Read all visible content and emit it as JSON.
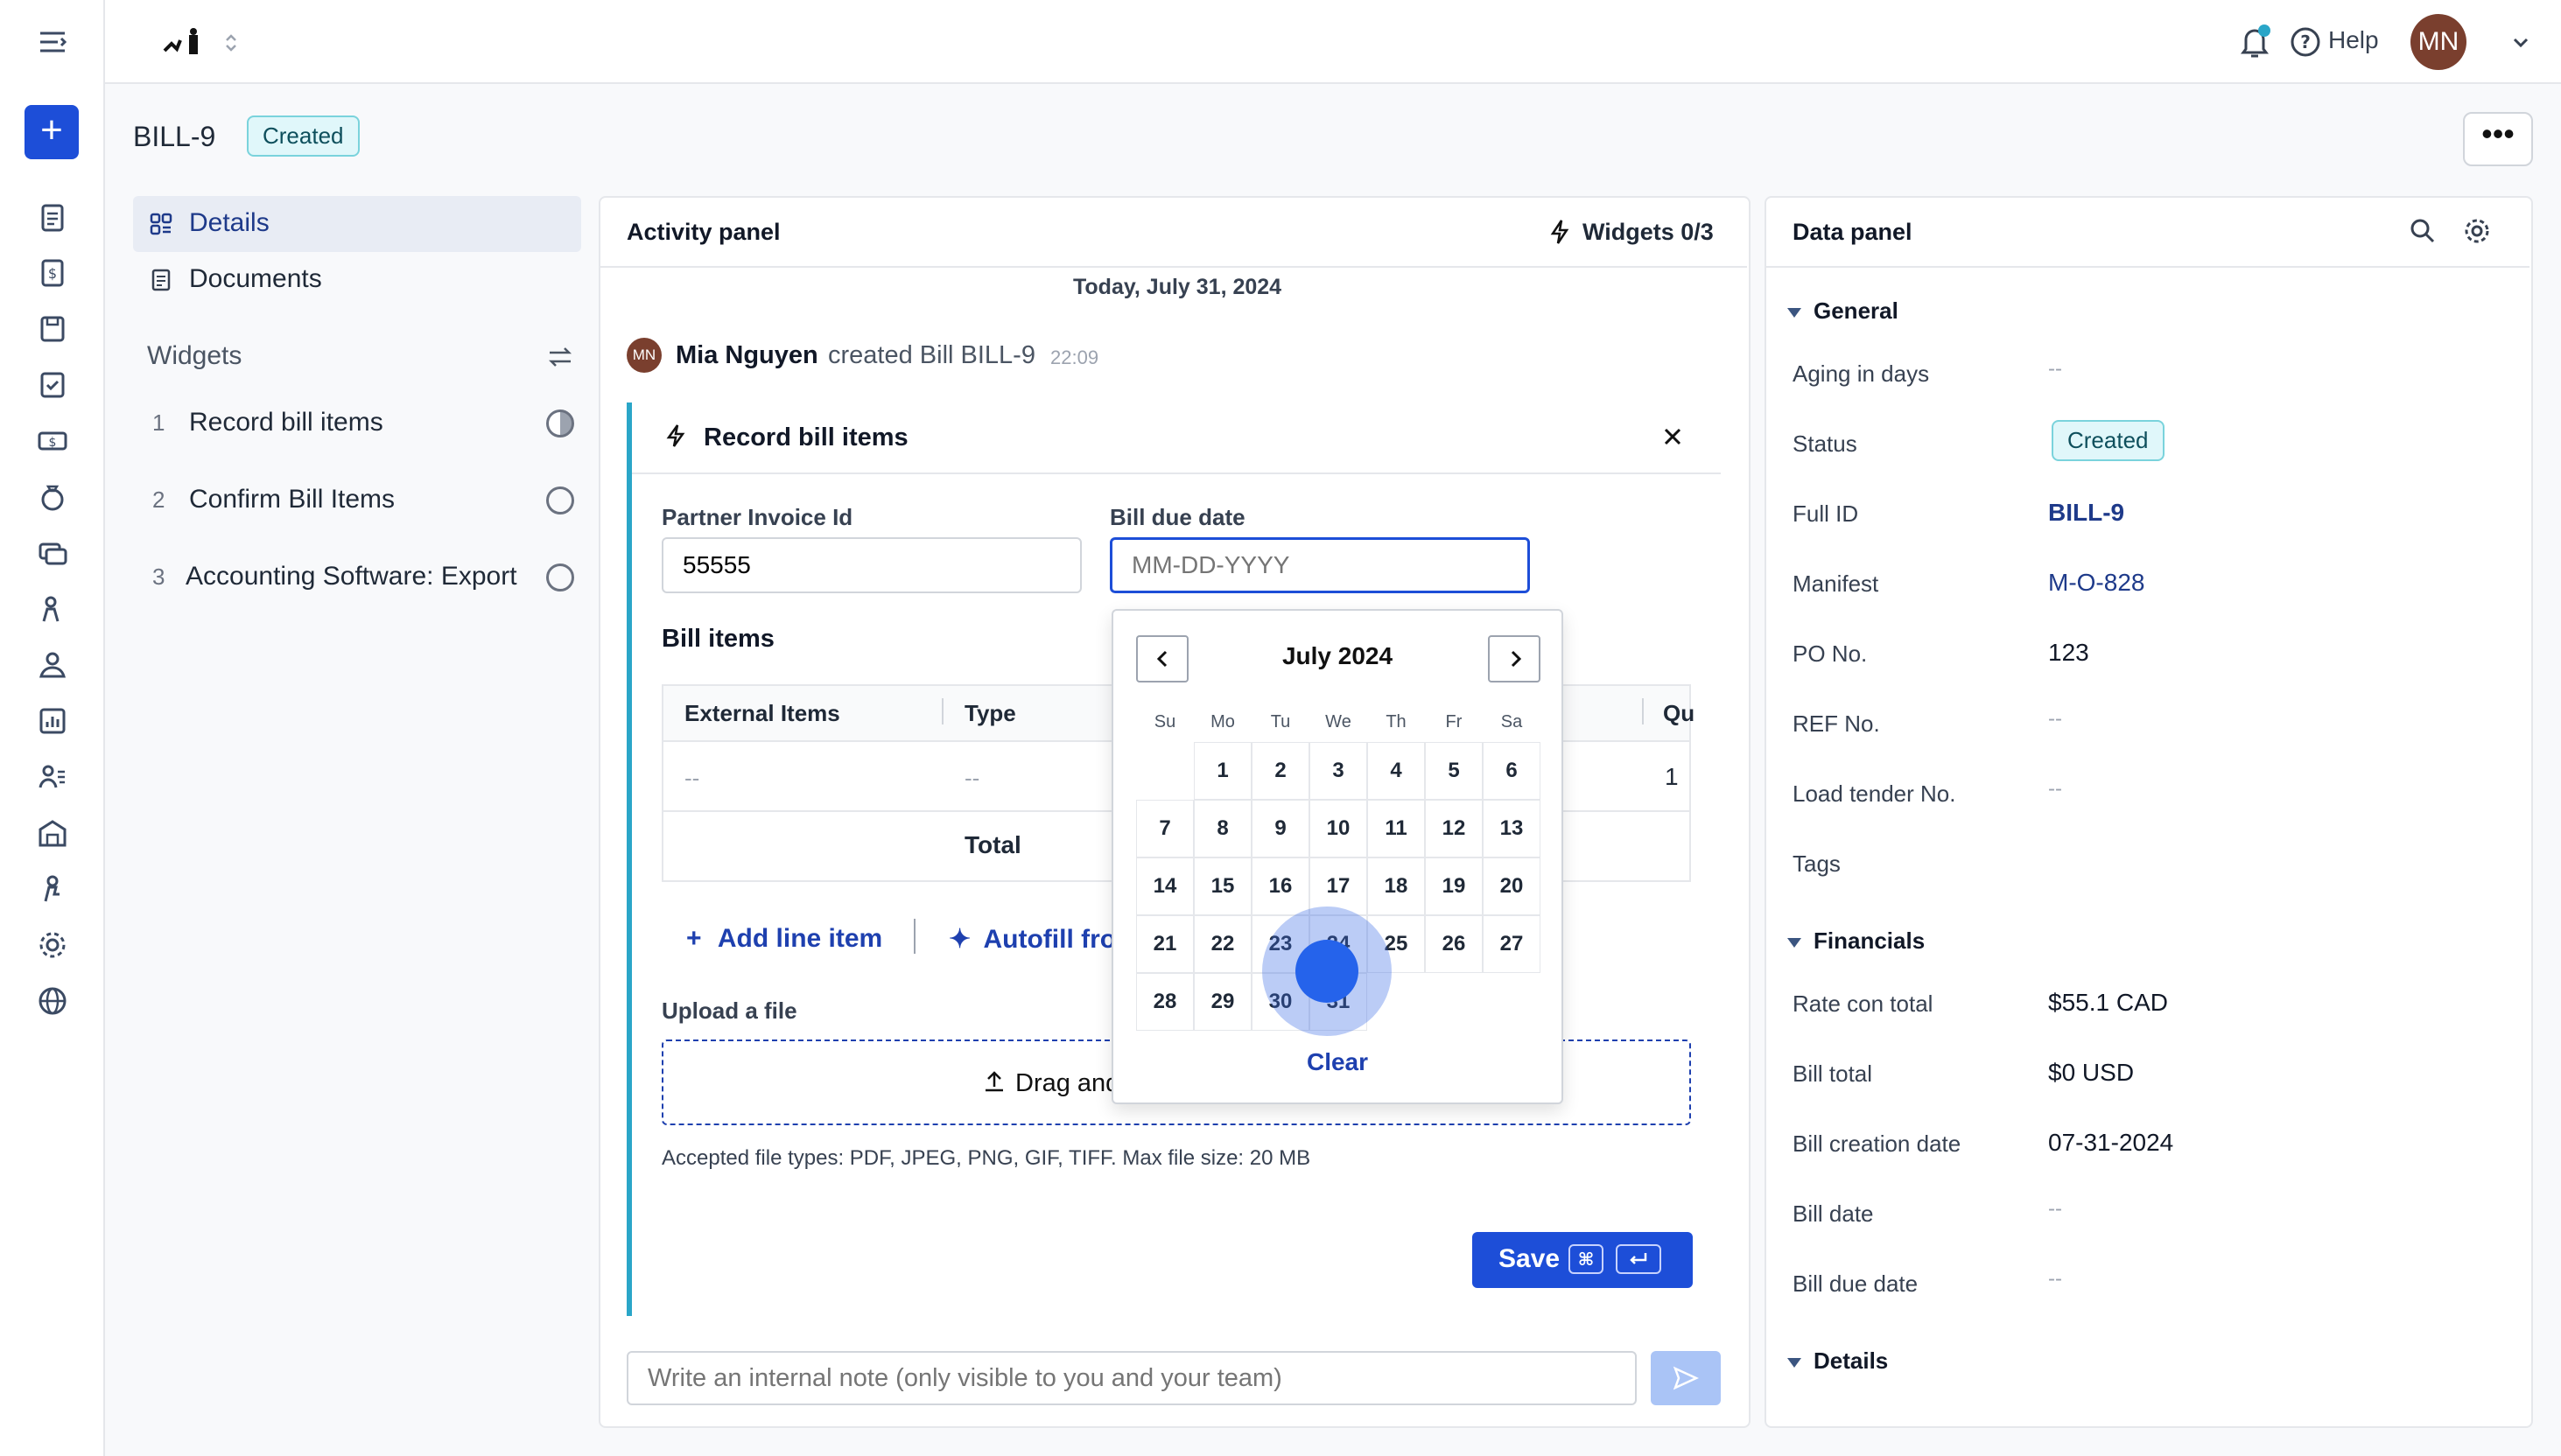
{
  "header": {
    "help_label": "Help",
    "avatar_initials": "MN"
  },
  "page": {
    "bill_id": "BILL-9",
    "status_badge": "Created"
  },
  "left_nav": {
    "tabs": [
      {
        "label": "Details"
      },
      {
        "label": "Documents"
      }
    ],
    "widgets_title": "Widgets",
    "widgets": [
      {
        "num": "1",
        "label": "Record bill items"
      },
      {
        "num": "2",
        "label": "Confirm Bill Items"
      },
      {
        "num": "3",
        "label": "Accounting Software: Export..."
      }
    ]
  },
  "activity": {
    "title": "Activity panel",
    "widgets_count": "Widgets 0/3",
    "date_header": "Today, July 31, 2024",
    "event": {
      "avatar_initials": "MN",
      "user": "Mia Nguyen",
      "action": "created Bill BILL-9",
      "time": "22:09"
    },
    "widget_title": "Record bill items",
    "partner_invoice_label": "Partner Invoice Id",
    "partner_invoice_value": "55555",
    "bill_due_date_label": "Bill due date",
    "bill_due_date_placeholder": "MM-DD-YYYY",
    "bill_items_title": "Bill items",
    "table": {
      "headers": [
        "External Items",
        "Type",
        "Qu"
      ],
      "row": [
        "--",
        "--",
        "1"
      ],
      "total_label": "Total"
    },
    "add_line_item": "Add line item",
    "autofill": "Autofill fro",
    "upload_label": "Upload a file",
    "drag_text": "Drag and",
    "accepted_types": "Accepted file types: PDF, JPEG, PNG, GIF, TIFF. Max file size: 20 MB",
    "save_label": "Save",
    "note_placeholder": "Write an internal note (only visible to you and your team)"
  },
  "calendar": {
    "month_label": "July 2024",
    "weekdays": [
      "Su",
      "Mo",
      "Tu",
      "We",
      "Th",
      "Fr",
      "Sa"
    ],
    "weeks": [
      [
        "",
        "1",
        "2",
        "3",
        "4",
        "5",
        "6"
      ],
      [
        "7",
        "8",
        "9",
        "10",
        "11",
        "12",
        "13"
      ],
      [
        "14",
        "15",
        "16",
        "17",
        "18",
        "19",
        "20"
      ],
      [
        "21",
        "22",
        "23",
        "24",
        "25",
        "26",
        "27"
      ],
      [
        "28",
        "29",
        "30",
        "31",
        "",
        "",
        ""
      ]
    ],
    "clear_label": "Clear"
  },
  "data_panel": {
    "title": "Data panel",
    "general_title": "General",
    "general": [
      {
        "label": "Aging in days",
        "value": "--"
      },
      {
        "label": "Status",
        "value": "Created"
      },
      {
        "label": "Full ID",
        "value": "BILL-9"
      },
      {
        "label": "Manifest",
        "value": "M-O-828"
      },
      {
        "label": "PO No.",
        "value": "123"
      },
      {
        "label": "REF No.",
        "value": "--"
      },
      {
        "label": "Load tender No.",
        "value": "--"
      },
      {
        "label": "Tags",
        "value": ""
      }
    ],
    "financials_title": "Financials",
    "financials": [
      {
        "label": "Rate con total",
        "value": "$55.1 CAD"
      },
      {
        "label": "Bill total",
        "value": "$0 USD"
      },
      {
        "label": "Bill creation date",
        "value": "07-31-2024"
      },
      {
        "label": "Bill date",
        "value": "--"
      },
      {
        "label": "Bill due date",
        "value": "--"
      }
    ],
    "details_title": "Details"
  },
  "colors": {
    "primary": "#1d4ed8",
    "accent_bar": "#2aa6c8",
    "badge_bg": "#e0f7fa",
    "link": "#1e3a8a"
  }
}
